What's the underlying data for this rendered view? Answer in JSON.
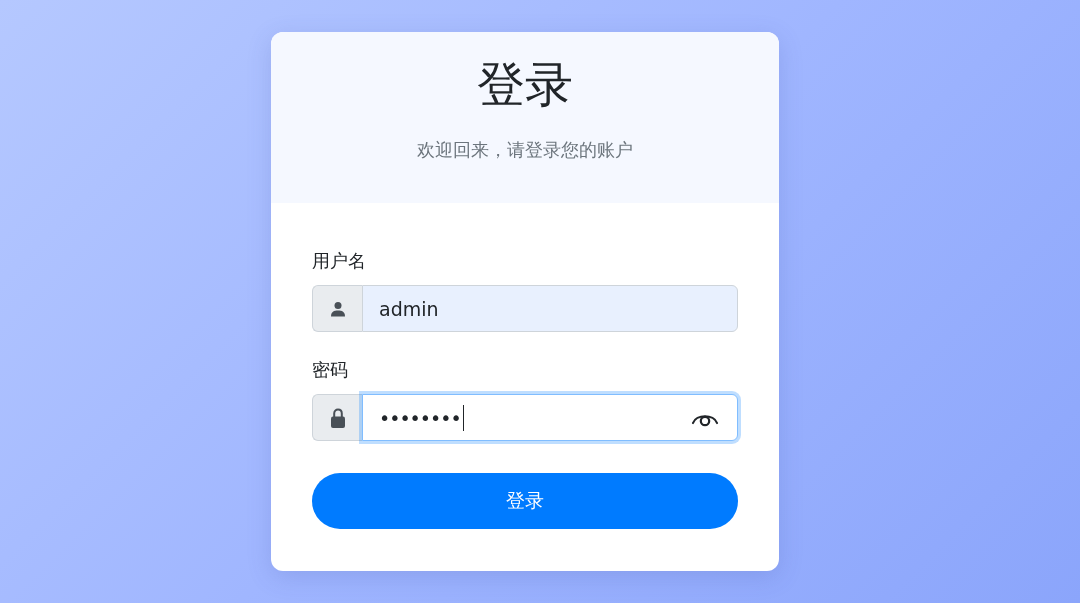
{
  "header": {
    "title": "登录",
    "subtitle": "欢迎回来，请登录您的账户"
  },
  "fields": [
    {
      "kind": "text",
      "label": "用户名",
      "value": "admin",
      "autofilled": true,
      "focused": false
    },
    {
      "kind": "password",
      "label": "密码",
      "value": "••••••••",
      "autofilled": false,
      "focused": true
    }
  ],
  "submit_button": {
    "label": "登录"
  }
}
